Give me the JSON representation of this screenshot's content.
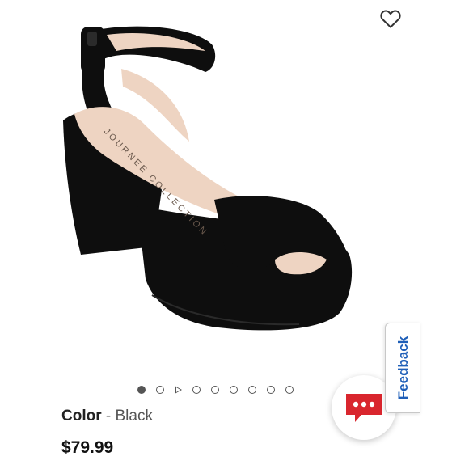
{
  "product": {
    "image_alt": "Black suede platform block-heel sandal with ankle strap",
    "insole_brand": "JOURNEE COLLECTION",
    "color_label": "Color",
    "color_separator": " - ",
    "color_value": "Black",
    "price": "$79.99"
  },
  "carousel": {
    "total_items": 9,
    "active_index": 0,
    "video_index": 1
  },
  "actions": {
    "wishlist_icon": "heart-outline-icon",
    "chat_icon": "chat-bubble-icon",
    "feedback_label": "Feedback"
  },
  "colors": {
    "shoe": "#0e0e0e",
    "insole": "#eed4c2",
    "feedback_text": "#1f5fb8",
    "chat_bubble": "#d9262e"
  }
}
